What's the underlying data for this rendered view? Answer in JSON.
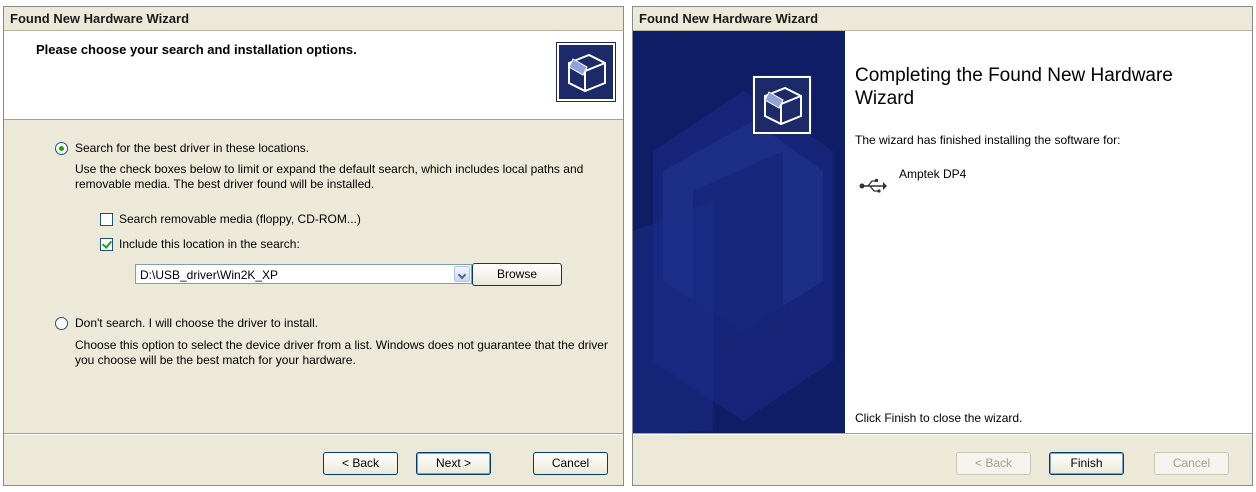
{
  "left": {
    "title": "Found New Hardware Wizard",
    "header_title": "Please choose your search and installation options.",
    "option1_label": "Search for the best driver in these locations.",
    "option1_desc": "Use the check boxes below to limit or expand the default search, which includes local paths and removable media. The best driver found will be installed.",
    "check1_label": "Search removable media (floppy, CD-ROM...)",
    "check2_label": "Include this location in the search:",
    "path_value": "D:\\USB_driver\\Win2K_XP",
    "browse_label": "Browse",
    "option2_label": "Don't search. I will choose the driver to install.",
    "option2_desc": "Choose this option to select the device driver from a list.  Windows does not guarantee that the driver you choose will be the best match for your hardware.",
    "back_label": "< Back",
    "next_label": "Next >",
    "cancel_label": "Cancel",
    "option1_selected": true,
    "check1_checked": false,
    "check2_checked": true
  },
  "right": {
    "title": "Found New Hardware Wizard",
    "heading": "Completing the Found New Hardware Wizard",
    "intro": "The wizard has finished installing the software for:",
    "device_name": "Amptek DP4",
    "close_hint": "Click Finish to close the wizard.",
    "back_label": "< Back",
    "finish_label": "Finish",
    "cancel_label": "Cancel"
  },
  "colors": {
    "dialog_bg": "#ece9d8",
    "banner_bg": "#0f1c66",
    "accent_green": "#21a121"
  },
  "icons": [
    "hardware-wizard-icon",
    "usb-icon",
    "dropdown-arrow-icon"
  ]
}
